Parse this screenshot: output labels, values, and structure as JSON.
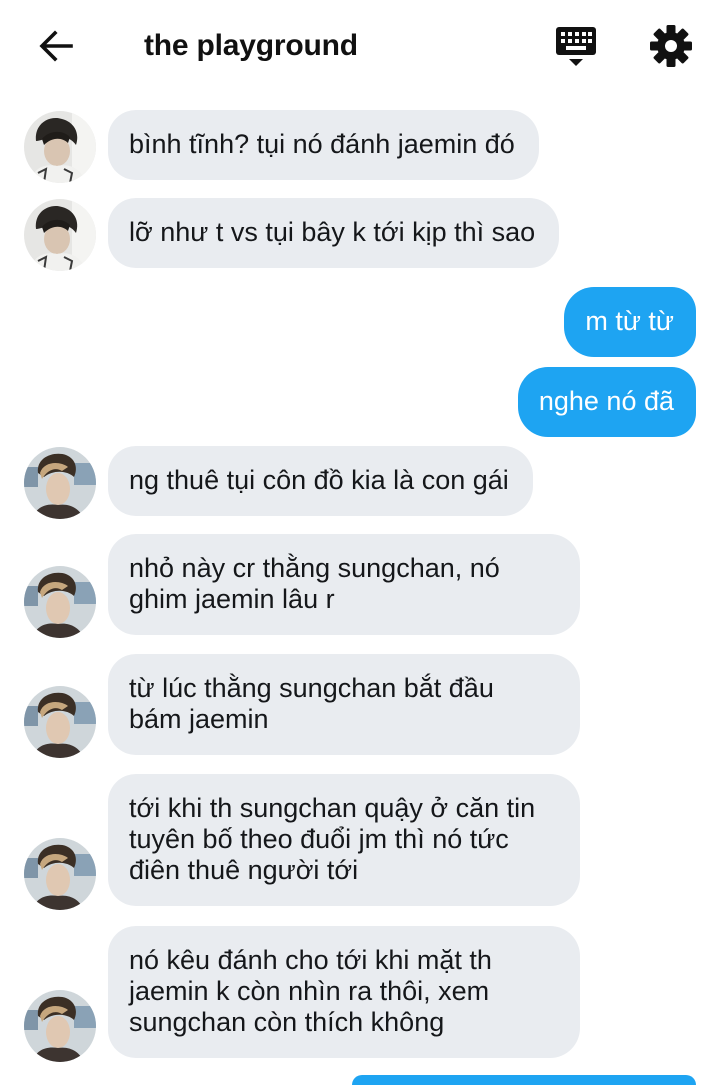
{
  "header": {
    "title": "the playground",
    "back_icon": "arrow-left-icon",
    "keyboard_icon": "keyboard-icon",
    "settings_icon": "gear-icon"
  },
  "colors": {
    "incoming_bubble": "#e9ecf0",
    "outgoing_bubble": "#1ea4f2",
    "text": "#15171a"
  },
  "messages": [
    {
      "side": "in",
      "text": "bình tĩnh? tụi nó đánh jaemin đó"
    },
    {
      "side": "in",
      "text": "lỡ như t vs tụi bây k tới kịp thì sao"
    },
    {
      "side": "out",
      "text": "m từ từ"
    },
    {
      "side": "out",
      "text": "nghe nó đã"
    },
    {
      "side": "in",
      "text": "ng thuê tụi côn đồ kia là con gái"
    },
    {
      "side": "in",
      "text": "nhỏ này cr thằng sungchan, nó\nghim jaemin lâu r"
    },
    {
      "side": "in",
      "text": "từ lúc thằng sungchan bắt đầu\nbám jaemin"
    },
    {
      "side": "in",
      "text": "tới khi th sungchan quậy ở căn tin\ntuyên bố theo đuổi jm thì nó tức\nđiên thuê người tới"
    },
    {
      "side": "in",
      "text": "nó kêu đánh cho tới khi mặt th\njaemin k còn nhìn ra thôi, xem\nsungchan còn thích không"
    }
  ]
}
